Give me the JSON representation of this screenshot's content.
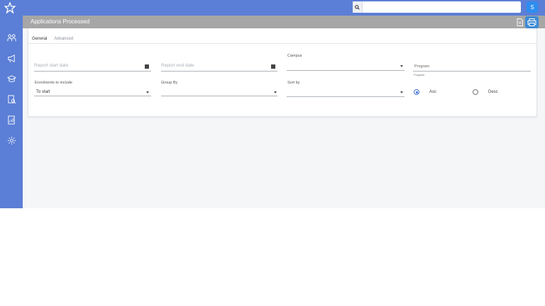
{
  "header": {
    "search_placeholder": "",
    "avatar_letter": "S"
  },
  "sidebar": {
    "items": [
      {
        "icon": "people-icon"
      },
      {
        "icon": "megaphone-icon"
      },
      {
        "icon": "graduation-cap-icon"
      },
      {
        "icon": "report-search-icon"
      },
      {
        "icon": "report-chart-icon"
      },
      {
        "icon": "settings-gear-icon"
      }
    ]
  },
  "panel": {
    "title": "Applications Processed",
    "tabs": [
      {
        "label": "General",
        "active": true
      },
      {
        "label": "Advanced",
        "active": false
      }
    ]
  },
  "form": {
    "report_start_date_placeholder": "Report start date",
    "report_end_date_placeholder": "Report end date",
    "campus_label": "Campus",
    "program_placeholder": "Program",
    "program_hint": "Program",
    "enrolments_label": "Enrolments to include",
    "enrolments_value": "To start",
    "group_by_label": "Group By",
    "sort_by_label": "Sort by",
    "asc_label": "Asc",
    "desc_label": "Desc",
    "sort_direction": "Asc"
  },
  "colors": {
    "brand": "#5b7fd6",
    "accent": "#3d8ad6",
    "header_bar": "#a6a6a6"
  }
}
